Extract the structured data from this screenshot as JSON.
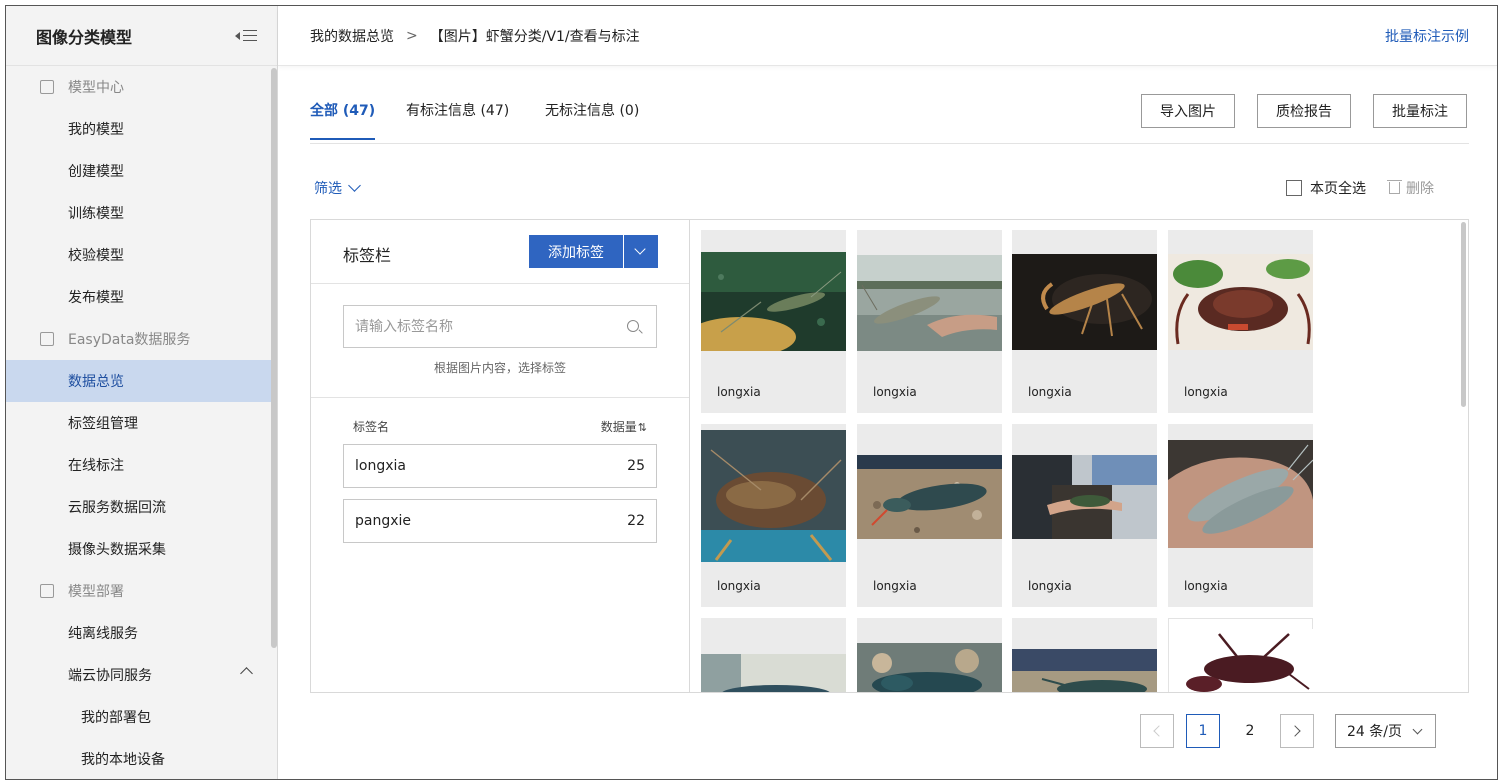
{
  "sidebar": {
    "title": "图像分类模型",
    "groups": [
      {
        "label": "模型中心",
        "items": [
          "我的模型",
          "创建模型",
          "训练模型",
          "校验模型",
          "发布模型"
        ]
      },
      {
        "label": "EasyData数据服务",
        "items": [
          "数据总览",
          "标签组管理",
          "在线标注",
          "云服务数据回流",
          "摄像头数据采集"
        ]
      },
      {
        "label": "模型部署",
        "items": [
          "纯离线服务",
          "端云协同服务"
        ]
      }
    ],
    "subitems": [
      "我的部署包",
      "我的本地设备"
    ],
    "active_item": "数据总览"
  },
  "breadcrumb": {
    "root": "我的数据总览",
    "separator": ">",
    "current": "【图片】虾蟹分类/V1/查看与标注"
  },
  "top_link": "批量标注示例",
  "tabs": [
    {
      "label": "全部 (47)"
    },
    {
      "label": "有标注信息 (47)"
    },
    {
      "label": "无标注信息 (0)"
    }
  ],
  "actions": {
    "import": "导入图片",
    "quality": "质检报告",
    "batch": "批量标注"
  },
  "filter_label": "筛选",
  "select_all": "本页全选",
  "delete_label": "删除",
  "label_panel": {
    "title": "标签栏",
    "add_button": "添加标签",
    "search_placeholder": "请输入标签名称",
    "hint": "根据图片内容，选择标签",
    "col_name": "标签名",
    "col_count": "数据量",
    "sort_icon": "⇅",
    "rows": [
      {
        "name": "longxia",
        "count": "25"
      },
      {
        "name": "pangxie",
        "count": "22"
      }
    ]
  },
  "images": [
    {
      "caption": "longxia"
    },
    {
      "caption": "longxia"
    },
    {
      "caption": "longxia"
    },
    {
      "caption": "longxia"
    },
    {
      "caption": "longxia"
    },
    {
      "caption": "longxia"
    },
    {
      "caption": "longxia"
    },
    {
      "caption": "longxia"
    },
    {
      "caption": ""
    },
    {
      "caption": ""
    },
    {
      "caption": ""
    },
    {
      "caption": ""
    }
  ],
  "pagination": {
    "pages": [
      "1",
      "2"
    ],
    "current": "1",
    "page_size": "24 条/页"
  },
  "colors": {
    "accent": "#1f5bb8",
    "button": "#2f65c1",
    "active_bg": "#c9d8ee"
  }
}
